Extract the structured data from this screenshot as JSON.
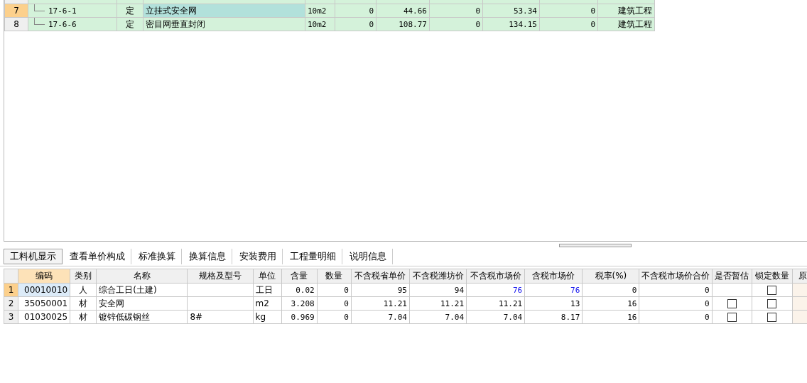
{
  "top_table": {
    "rows": [
      {
        "number": "7",
        "selected": true,
        "code": "17-6-1",
        "type": "定",
        "name": "立挂式安全网",
        "unit": "10m2",
        "column_6": "0",
        "column_7": "44.66",
        "column_8": "0",
        "column_9": "53.34",
        "column_10": "0",
        "category": "建筑工程"
      },
      {
        "number": "8",
        "selected": false,
        "code": "17-6-6",
        "type": "定",
        "name": "密目网垂直封闭",
        "unit": "10m2",
        "column_6": "0",
        "column_7": "108.77",
        "column_8": "0",
        "column_9": "134.15",
        "column_10": "0",
        "category": "建筑工程"
      }
    ]
  },
  "tabs": [
    {
      "label": "工料机显示",
      "selected": true
    },
    {
      "label": "查看单价构成",
      "selected": false
    },
    {
      "label": "标准换算",
      "selected": false
    },
    {
      "label": "换算信息",
      "selected": false
    },
    {
      "label": "安装费用",
      "selected": false
    },
    {
      "label": "工程量明细",
      "selected": false
    },
    {
      "label": "说明信息",
      "selected": false
    }
  ],
  "resource_table": {
    "columns": [
      "编码",
      "类别",
      "名称",
      "规格及型号",
      "单位",
      "含量",
      "数量",
      "不含税省单价",
      "不含税潍坊价",
      "不含税市场价",
      "含税市场价",
      "税率(%)",
      "不含税市场价合价",
      "是否暂估",
      "锁定数量",
      "原"
    ],
    "rows": [
      {
        "number": "1",
        "selected": true,
        "code": "00010010",
        "type": "人",
        "name": "综合工日(土建)",
        "spec": "",
        "unit": "工日",
        "content": "0.02",
        "quantity": "0",
        "province_price": "95",
        "weifang_price": "94",
        "market_price": "76",
        "tax_market_price": "76",
        "price_adjusted": true,
        "tax_rate": "0",
        "total": "0",
        "lock_checked": false
      },
      {
        "number": "2",
        "selected": false,
        "code": "35050001",
        "type": "材",
        "name": "安全网",
        "spec": "",
        "unit": "m2",
        "content": "3.208",
        "quantity": "0",
        "province_price": "11.21",
        "weifang_price": "11.21",
        "market_price": "11.21",
        "tax_market_price": "13",
        "price_adjusted": false,
        "tax_rate": "16",
        "total": "0",
        "estimate_checked": false,
        "lock_checked": false
      },
      {
        "number": "3",
        "selected": false,
        "code": "01030025",
        "type": "材",
        "name": "镀锌低碳钢丝",
        "spec": "8#",
        "unit": "kg",
        "content": "0.969",
        "quantity": "0",
        "province_price": "7.04",
        "weifang_price": "7.04",
        "market_price": "7.04",
        "tax_market_price": "8.17",
        "price_adjusted": false,
        "tax_rate": "16",
        "total": "0",
        "estimate_checked": false,
        "lock_checked": false
      }
    ]
  }
}
